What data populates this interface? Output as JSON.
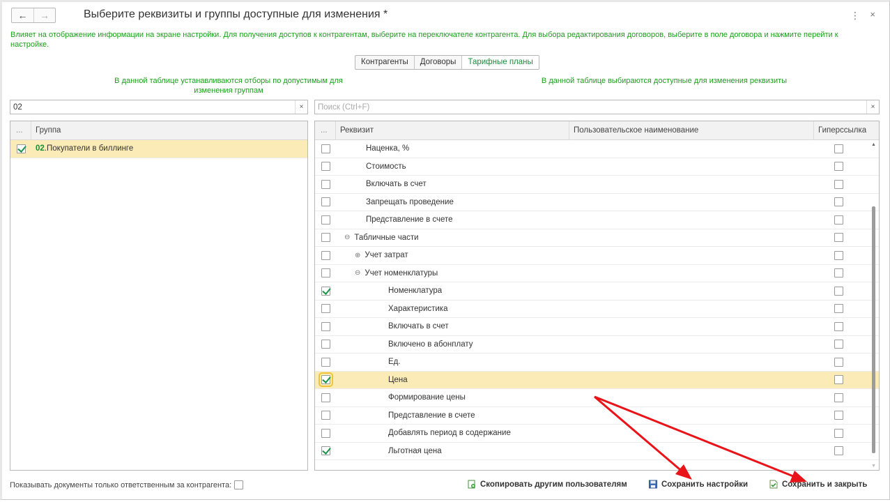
{
  "window": {
    "title": "Выберите реквизиты и группы доступные для изменения *",
    "back_icon": "arrow-left-icon",
    "forward_icon": "arrow-right-icon",
    "back_glyph": "←",
    "forward_glyph": "→",
    "menu_glyph": "⋮",
    "close_glyph": "×"
  },
  "info_text": "Влияет на отображение информации на экране настройки. Для получения доступов к контрагентам, выберите на переключателе контрагента. Для выбора редактирования договоров, выберите в поле договора и нажмите перейти к настройке.",
  "switcher": {
    "options": [
      "Контрагенты",
      "Договоры",
      "Тарифные планы"
    ],
    "active": "Тарифные планы"
  },
  "left_panel": {
    "hint": "В данной таблице устанавливаются отборы по допустимым для изменения группам",
    "search_value": "02",
    "clear_glyph": "×",
    "columns": {
      "dots": "...",
      "group": "Группа"
    },
    "rows": [
      {
        "code": "02",
        "name": ".Покупатели в биллинге",
        "checked": true,
        "selected": true
      }
    ]
  },
  "right_panel": {
    "hint": "В данной таблице выбираются доступные для изменения реквизиты",
    "search_placeholder": "Поиск (Ctrl+F)",
    "clear_glyph": "×",
    "columns": {
      "dots": "...",
      "attribute": "Реквизит",
      "custom_name": "Пользовательское наименование",
      "hyperlink": "Гиперссылка"
    },
    "rows": [
      {
        "name": "Наценка, %",
        "level": 1,
        "toggle": "",
        "checked": false,
        "hyperlink": false,
        "selected": false
      },
      {
        "name": "Стоимость",
        "level": 1,
        "toggle": "",
        "checked": false,
        "hyperlink": false,
        "selected": false
      },
      {
        "name": "Включать в счет",
        "level": 1,
        "toggle": "",
        "checked": false,
        "hyperlink": false,
        "selected": false
      },
      {
        "name": "Запрещать проведение",
        "level": 1,
        "toggle": "",
        "checked": false,
        "hyperlink": false,
        "selected": false
      },
      {
        "name": "Представление в счете",
        "level": 1,
        "toggle": "",
        "checked": false,
        "hyperlink": false,
        "selected": false
      },
      {
        "name": "Табличные части",
        "level": 0,
        "toggle": "⊖",
        "checked": false,
        "hyperlink": false,
        "selected": false
      },
      {
        "name": "Учет затрат",
        "level": 1,
        "toggle": "⊕",
        "checked": false,
        "hyperlink": false,
        "selected": false
      },
      {
        "name": "Учет номенклатуры",
        "level": 1,
        "toggle": "⊖",
        "checked": false,
        "hyperlink": false,
        "selected": false
      },
      {
        "name": "Номенклатура",
        "level": 2,
        "toggle": "",
        "checked": true,
        "hyperlink": false,
        "selected": false
      },
      {
        "name": "Характеристика",
        "level": 2,
        "toggle": "",
        "checked": false,
        "hyperlink": false,
        "selected": false
      },
      {
        "name": "Включать в счет",
        "level": 2,
        "toggle": "",
        "checked": false,
        "hyperlink": false,
        "selected": false
      },
      {
        "name": "Включено в абонплату",
        "level": 2,
        "toggle": "",
        "checked": false,
        "hyperlink": false,
        "selected": false
      },
      {
        "name": "Ед.",
        "level": 2,
        "toggle": "",
        "checked": false,
        "hyperlink": false,
        "selected": false
      },
      {
        "name": "Цена",
        "level": 2,
        "toggle": "",
        "checked": true,
        "hyperlink": false,
        "selected": true
      },
      {
        "name": "Формирование цены",
        "level": 2,
        "toggle": "",
        "checked": false,
        "hyperlink": false,
        "selected": false
      },
      {
        "name": "Представление в счете",
        "level": 2,
        "toggle": "",
        "checked": false,
        "hyperlink": false,
        "selected": false
      },
      {
        "name": "Добавлять период в содержание",
        "level": 2,
        "toggle": "",
        "checked": false,
        "hyperlink": false,
        "selected": false
      },
      {
        "name": "Льготная цена",
        "level": 2,
        "toggle": "",
        "checked": true,
        "hyperlink": false,
        "selected": false
      }
    ]
  },
  "footer": {
    "responsible_label": "Показывать документы только ответственным за контрагента:",
    "responsible_checked": false,
    "copy_label": "Скопировать другим пользователям",
    "save_label": "Сохранить настройки",
    "save_close_label": "Сохранить и закрыть"
  },
  "colors": {
    "accent_green": "#19a019",
    "selection": "#fbecb7",
    "annotation_arrow": "#e8141a"
  }
}
